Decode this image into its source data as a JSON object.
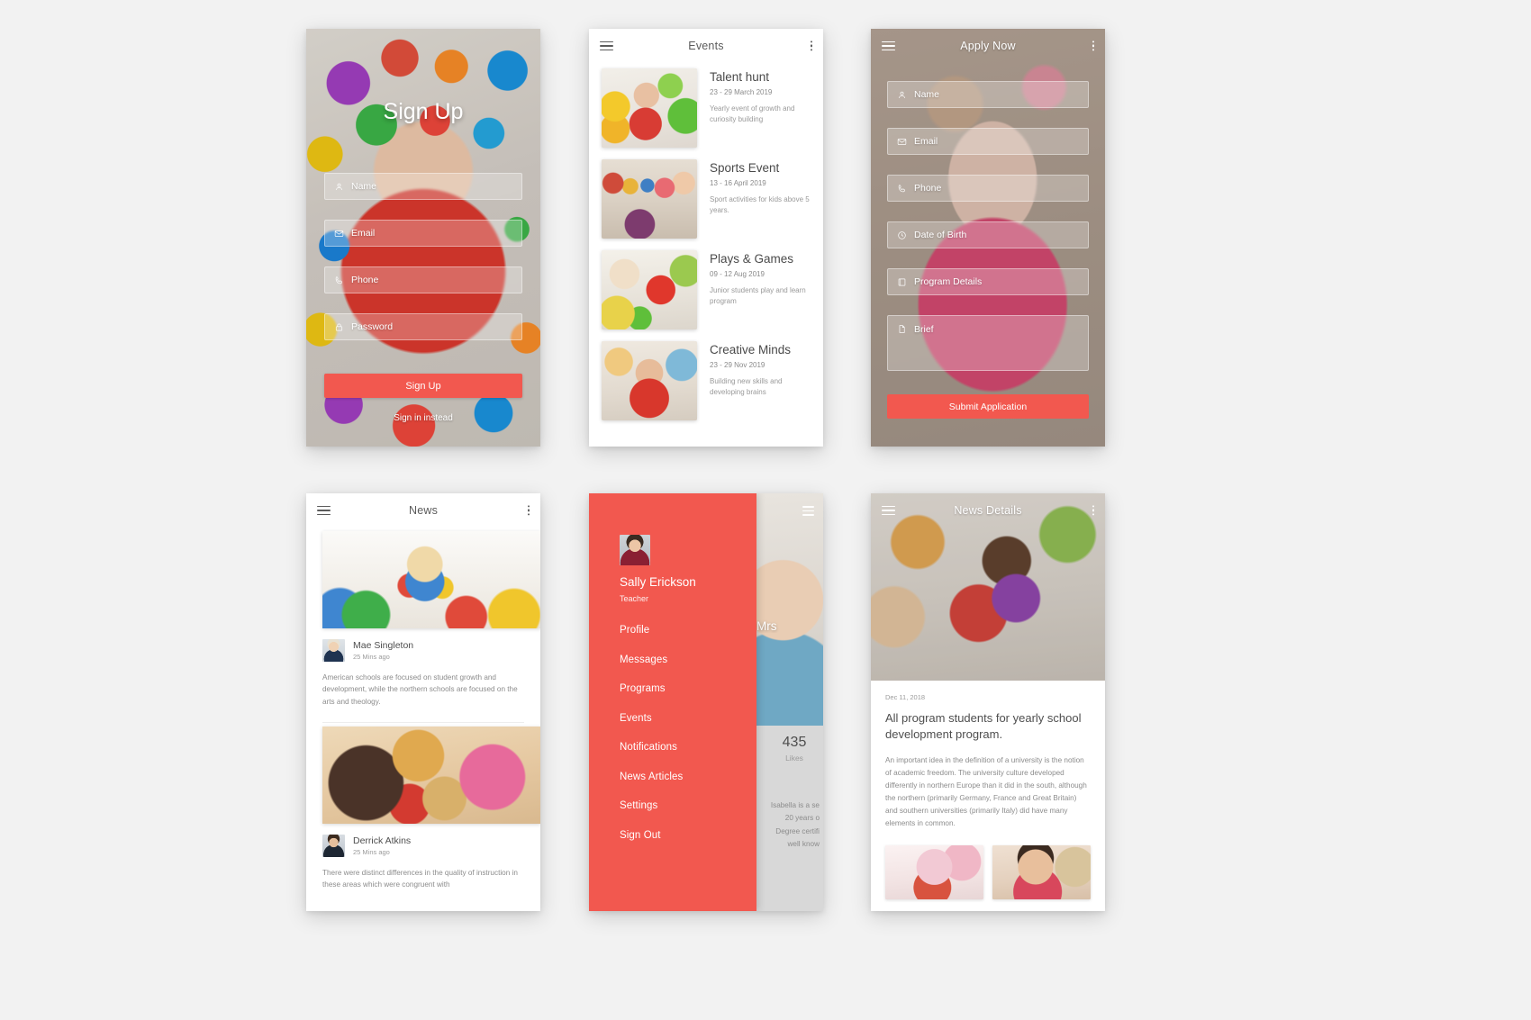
{
  "theme": {
    "accent": "#f2584f",
    "text_dark": "#4e4e4e",
    "text_muted": "#8c8c8c",
    "background": "#f2f2f2"
  },
  "signup": {
    "title": "Sign Up",
    "fields": [
      {
        "icon": "user-icon",
        "label": "Name"
      },
      {
        "icon": "envelope-icon",
        "label": "Email"
      },
      {
        "icon": "phone-icon",
        "label": "Phone"
      },
      {
        "icon": "lock-icon",
        "label": "Password"
      }
    ],
    "submit_label": "Sign Up",
    "secondary_link": "Sign in instead"
  },
  "events": {
    "appbar": {
      "title": "Events",
      "menu_icon": "hamburger-icon",
      "overflow_icon": "kebab-icon"
    },
    "items": [
      {
        "name": "Talent hunt",
        "date": "23 - 29 March 2019",
        "description": "Yearly event of growth and curiosity building"
      },
      {
        "name": "Sports Event",
        "date": "13 - 16 April 2019",
        "description": "Sport activities for kids above 5 years."
      },
      {
        "name": "Plays & Games",
        "date": "09 - 12 Aug 2019",
        "description": "Junior students play and learn program"
      },
      {
        "name": "Creative Minds",
        "date": "23 - 29 Nov 2019",
        "description": "Building new skills and developing brains"
      }
    ]
  },
  "apply": {
    "appbar": {
      "title": "Apply Now",
      "menu_icon": "hamburger-icon",
      "overflow_icon": "kebab-icon"
    },
    "fields": [
      {
        "icon": "user-icon",
        "label": "Name"
      },
      {
        "icon": "envelope-icon",
        "label": "Email"
      },
      {
        "icon": "phone-icon",
        "label": "Phone"
      },
      {
        "icon": "clock-icon",
        "label": "Date of Birth"
      },
      {
        "icon": "book-icon",
        "label": "Program Details"
      },
      {
        "icon": "document-icon",
        "label": "Brief"
      }
    ],
    "submit_label": "Submit Application"
  },
  "news": {
    "appbar": {
      "title": "News",
      "menu_icon": "hamburger-icon",
      "overflow_icon": "kebab-icon"
    },
    "posts": [
      {
        "author": "Mae Singleton",
        "time": "25 Mins ago",
        "body": "American schools are focused on student growth and development, while the northern schools are focused on the arts and theology."
      },
      {
        "author": "Derrick Atkins",
        "time": "25 Mins ago",
        "body": "There were distinct differences in the quality of instruction in these areas which were congruent with"
      }
    ]
  },
  "drawer": {
    "profile": {
      "name": "Sally Erickson",
      "role": "Teacher",
      "avatar": "user-avatar"
    },
    "items": [
      {
        "label": "Profile"
      },
      {
        "label": "Messages"
      },
      {
        "label": "Programs"
      },
      {
        "label": "Events"
      },
      {
        "label": "Notifications"
      },
      {
        "label": "News Articles"
      },
      {
        "label": "Settings"
      },
      {
        "label": "Sign Out"
      }
    ],
    "underlay": {
      "title": "Mrs",
      "likes_count": "435",
      "likes_label": "Likes",
      "bio_lines": [
        "Isabella is a se",
        "20 years o",
        "Degree certifi",
        "well know"
      ]
    }
  },
  "details": {
    "appbar": {
      "title": "News Details",
      "menu_icon": "hamburger-icon",
      "overflow_icon": "kebab-icon"
    },
    "date": "Dec 11, 2018",
    "headline": "All program students for yearly school development program.",
    "body": "An important idea in the definition of a university is the notion of academic freedom. The university culture developed differently in northern Europe than it did in the south, although the northern (primarily Germany, France and Great Britain) and southern universities (primarily Italy) did have many elements in common.",
    "gallery": [
      {
        "name": "gallery-photo-1"
      },
      {
        "name": "gallery-photo-2"
      }
    ]
  }
}
